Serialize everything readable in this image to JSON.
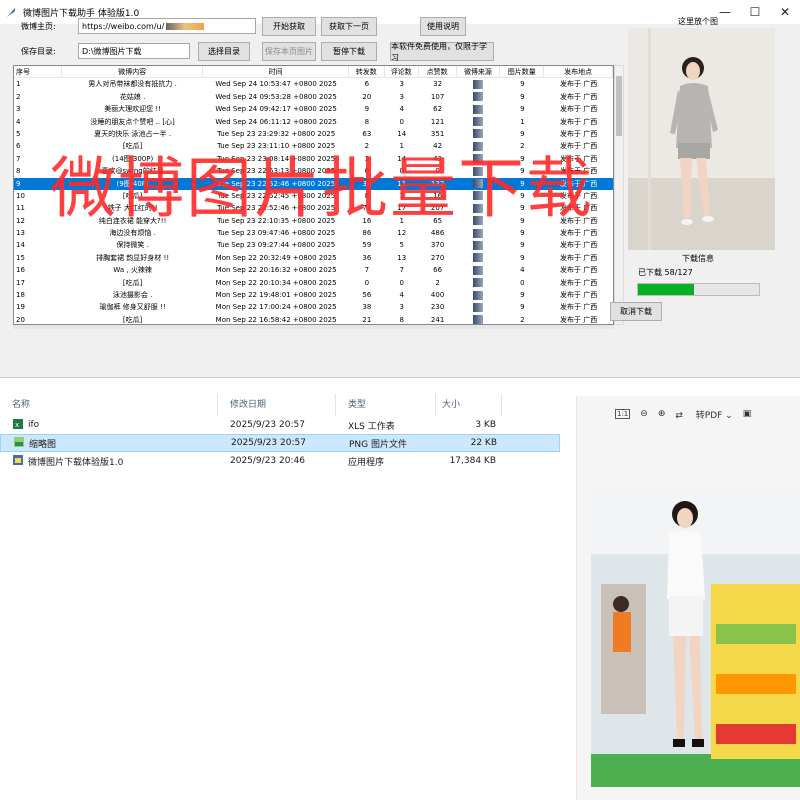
{
  "window": {
    "title": "微博图片下载助手 体验版1.0",
    "controls": [
      "—",
      "☐",
      "✕"
    ]
  },
  "form": {
    "home_label": "微博主页:",
    "home_url": "https://weibo.com/u/",
    "save_label": "保存目录:",
    "save_path": "D:\\微博图片下载",
    "btn_start": "开始获取",
    "btn_next_page": "获取下一页",
    "btn_help": "使用说明",
    "btn_choose_dir": "选择目录",
    "btn_save_page_imgs": "保存本页图片",
    "btn_pause": "暂停下载",
    "notice": "本软件免费使用，仅限于学习"
  },
  "table": {
    "headers": [
      "序号",
      "微博内容",
      "时间",
      "转发数",
      "评论数",
      "点赞数",
      "微博来源",
      "图片数量",
      "发布地点"
    ],
    "selected_index": 8,
    "rows": [
      [
        "1",
        "男人对吊带袜都没有抵抗力 .",
        "Wed Sep 24 10:53:47 +0800 2025",
        "6",
        "3",
        "32",
        "",
        "9",
        "发布于 广西"
      ],
      [
        "2",
        "花姑娘 .",
        "Wed Sep 24 09:53:28 +0800 2025",
        "20",
        "3",
        "107",
        "",
        "9",
        "发布于 广西"
      ],
      [
        "3",
        "美丽大理欢迎您 !!",
        "Wed Sep 24 09:42:17 +0800 2025",
        "9",
        "4",
        "62",
        "",
        "9",
        "发布于 广西"
      ],
      [
        "4",
        "没睡的朋友点个赞吧 ..   [心]",
        "Wed Sep 24 06:11:12 +0800 2025",
        "8",
        "0",
        "121",
        "",
        "1",
        "发布于 广西"
      ],
      [
        "5",
        "夏天的快乐  泳池占一半 .",
        "Tue Sep 23 23:29:32 +0800 2025",
        "63",
        "14",
        "351",
        "",
        "9",
        "发布于 广西"
      ],
      [
        "6",
        "[吃瓜]",
        "Tue Sep 23 23:11:10 +0800 2025",
        "2",
        "1",
        "42",
        "",
        "2",
        "发布于 广西"
      ],
      [
        "7",
        "(14图 300P)",
        "Tue Sep 23 23:08:14 +0800 2025",
        "3",
        "14",
        "43",
        "",
        "9",
        "发布于 广西"
      ],
      [
        "8",
        "喜欢@swing的红皇",
        "Tue Sep 23 22:53:13 +0800 2025",
        "0",
        "0",
        "0",
        "",
        "9",
        "发布于 广西"
      ],
      [
        "9",
        "(9图 40P)",
        "Tue Sep 23 22:52:46 +0800 2025",
        "38",
        "11",
        "132",
        "",
        "9",
        "发布于 广西"
      ],
      [
        "10",
        "[吃瓜]",
        "Tue Sep 23 22:52:45 +0800 2025",
        "8",
        "1",
        "16",
        "",
        "9",
        "发布于 广西"
      ],
      [
        "11",
        "铁子 大红红的!!",
        "Tue Sep 23 22:52:46 +0800 2025",
        "71",
        "17",
        "207",
        "",
        "9",
        "发布于 广西"
      ],
      [
        "12",
        "纯白连衣裙  能穿大?!!",
        "Tue Sep 23 22:10:35 +0800 2025",
        "16",
        "1",
        "65",
        "",
        "9",
        "发布于 广西"
      ],
      [
        "13",
        "海边没有烦恼 .",
        "Tue Sep 23 09:47:46 +0800 2025",
        "86",
        "12",
        "486",
        "",
        "9",
        "发布于 广西"
      ],
      [
        "14",
        "保持微笑 .",
        "Tue Sep 23 09:27:44 +0800 2025",
        "59",
        "5",
        "370",
        "",
        "9",
        "发布于 广西"
      ],
      [
        "15",
        "排胸套裙  韵显好身材 !!",
        "Mon Sep 22 20:32:49 +0800 2025",
        "36",
        "13",
        "270",
        "",
        "9",
        "发布于 广西"
      ],
      [
        "16",
        "Wa , 火辣辣",
        "Mon Sep 22 20:16:32 +0800 2025",
        "7",
        "7",
        "66",
        "",
        "4",
        "发布于 广西"
      ],
      [
        "17",
        "[吃瓜]",
        "Mon Sep 22 20:10:34 +0800 2025",
        "0",
        "0",
        "2",
        "",
        "0",
        "发布于 广西"
      ],
      [
        "18",
        "泳池摄影会 .",
        "Mon Sep 22 19:48:01 +0800 2025",
        "56",
        "4",
        "400",
        "",
        "9",
        "发布于 广西"
      ],
      [
        "19",
        "瑜伽裤  修身又舒服 !!",
        "Mon Sep 22 17:00:24 +0800 2025",
        "38",
        "3",
        "230",
        "",
        "9",
        "发布于 广西"
      ],
      [
        "20",
        "[吃瓜]",
        "Mon Sep 22 16:58:42 +0800 2025",
        "21",
        "8",
        "241",
        "",
        "2",
        "发布于 广西"
      ]
    ]
  },
  "preview": {
    "title": "这里放个图",
    "download_info_label": "下载信息",
    "download_count": "已下载 58/127",
    "progress_fraction": 0.46,
    "cancel_button": "取消下载"
  },
  "overlay_text": "微博图片批量下载",
  "explorer": {
    "headers": [
      "名称",
      "修改日期",
      "类型",
      "大小"
    ],
    "files": [
      {
        "name": "ifo",
        "date": "2025/9/23 20:57",
        "type": "XLS 工作表",
        "size": "3 KB",
        "icon": "excel-icon"
      },
      {
        "name": "缩略图",
        "date": "2025/9/23 20:57",
        "type": "PNG 图片文件",
        "size": "22 KB",
        "icon": "png-icon",
        "selected": true
      },
      {
        "name": "微博图片下载体验版1.0",
        "date": "2025/9/23 20:46",
        "type": "应用程序",
        "size": "17,384 KB",
        "icon": "app-icon"
      }
    ]
  },
  "viewer": {
    "toolbar": [
      "1:1",
      "zoom-out",
      "zoom-in",
      "转PDF",
      "image-edit"
    ]
  },
  "colors": {
    "selection_blue": "#0078d7",
    "progress_green": "#06b025",
    "overlay_red": "#ff2a2a",
    "explorer_selection": "#cce8ff"
  }
}
